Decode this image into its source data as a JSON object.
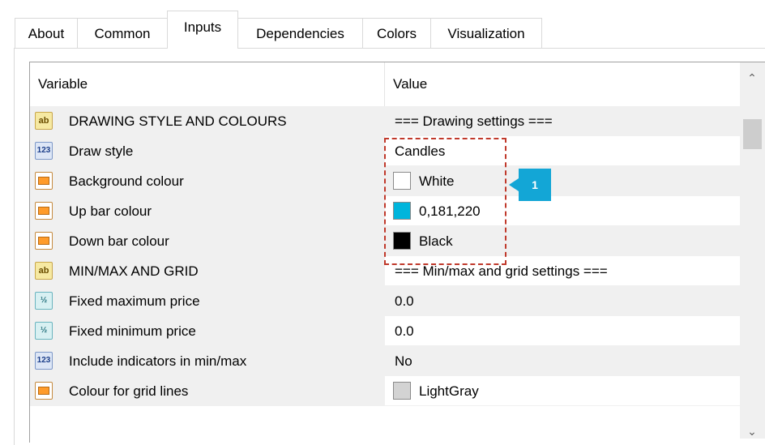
{
  "tabs": [
    {
      "label": "About",
      "active": false
    },
    {
      "label": "Common",
      "active": false
    },
    {
      "label": "Inputs",
      "active": true
    },
    {
      "label": "Dependencies",
      "active": false
    },
    {
      "label": "Colors",
      "active": false
    },
    {
      "label": "Visualization",
      "active": false
    }
  ],
  "grid": {
    "header_variable": "Variable",
    "header_value": "Value",
    "rows": [
      {
        "icon": "string-icon",
        "icon_text": "ab",
        "name": "DRAWING STYLE AND COLOURS",
        "value": "=== Drawing settings ==="
      },
      {
        "icon": "integer-icon",
        "icon_text": "123",
        "name": "Draw style",
        "value": "Candles"
      },
      {
        "icon": "color-icon",
        "name": "Background colour",
        "value": "White",
        "swatch": "#ffffff"
      },
      {
        "icon": "color-icon",
        "name": "Up bar colour",
        "value": "0,181,220",
        "swatch": "#00b5dc"
      },
      {
        "icon": "color-icon",
        "name": "Down bar colour",
        "value": "Black",
        "swatch": "#000000"
      },
      {
        "icon": "string-icon",
        "icon_text": "ab",
        "name": "MIN/MAX AND GRID",
        "value": "=== Min/max and grid settings ==="
      },
      {
        "icon": "double-icon",
        "icon_text": "½",
        "name": "Fixed maximum price",
        "value": "0.0"
      },
      {
        "icon": "double-icon",
        "icon_text": "½",
        "name": "Fixed minimum price",
        "value": "0.0"
      },
      {
        "icon": "integer-icon",
        "icon_text": "123",
        "name": "Include indicators in min/max",
        "value": "No"
      },
      {
        "icon": "color-icon",
        "name": "Colour for grid lines",
        "value": "LightGray",
        "swatch": "#d3d3d3"
      }
    ]
  },
  "callout": {
    "number": "1",
    "color": "#13a6d6"
  },
  "highlight_color": "#c0392b"
}
